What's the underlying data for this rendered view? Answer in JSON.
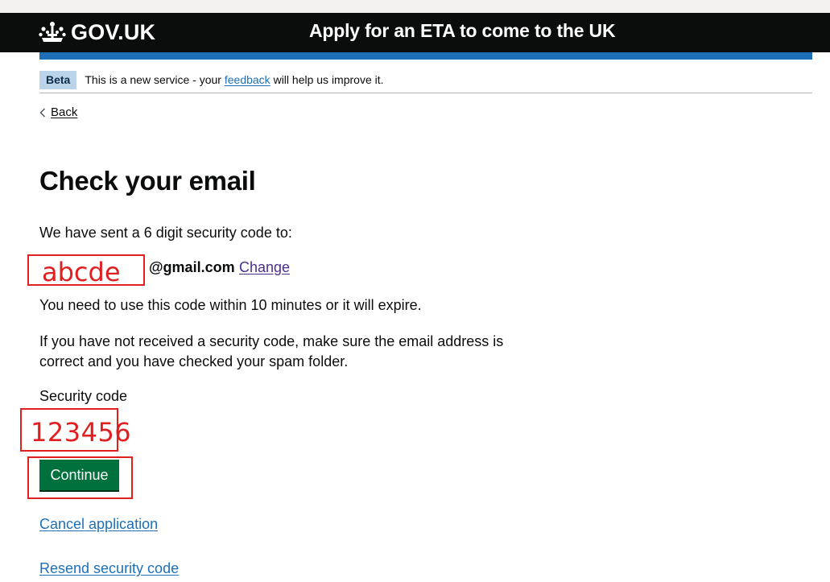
{
  "header": {
    "logo_text": "GOV.UK",
    "service_name": "Apply for an ETA to come to the UK"
  },
  "phase_banner": {
    "tag": "Beta",
    "text_before": "This is a new service - your ",
    "link": "feedback",
    "text_after": " will help us improve it."
  },
  "back_link": "Back",
  "page_title": "Check your email",
  "sent_text": "We have sent a 6 digit security code to:",
  "email": {
    "user": "abcde",
    "domain": "@gmail.com",
    "change_link": "Change"
  },
  "expire_text": "You need to use this code within 10 minutes or it will expire.",
  "spam_text": "If you have not received a security code, make sure the email address is correct and you have checked your spam folder.",
  "security_code": {
    "label": "Security code",
    "value": "123456"
  },
  "continue_button": "Continue",
  "cancel_link": "Cancel application",
  "resend_link": "Resend security code",
  "colors": {
    "header_bg": "#0b0c0c",
    "accent_blue": "#1d70b8",
    "button_green": "#00703c",
    "annotation_red": "#e02020"
  }
}
